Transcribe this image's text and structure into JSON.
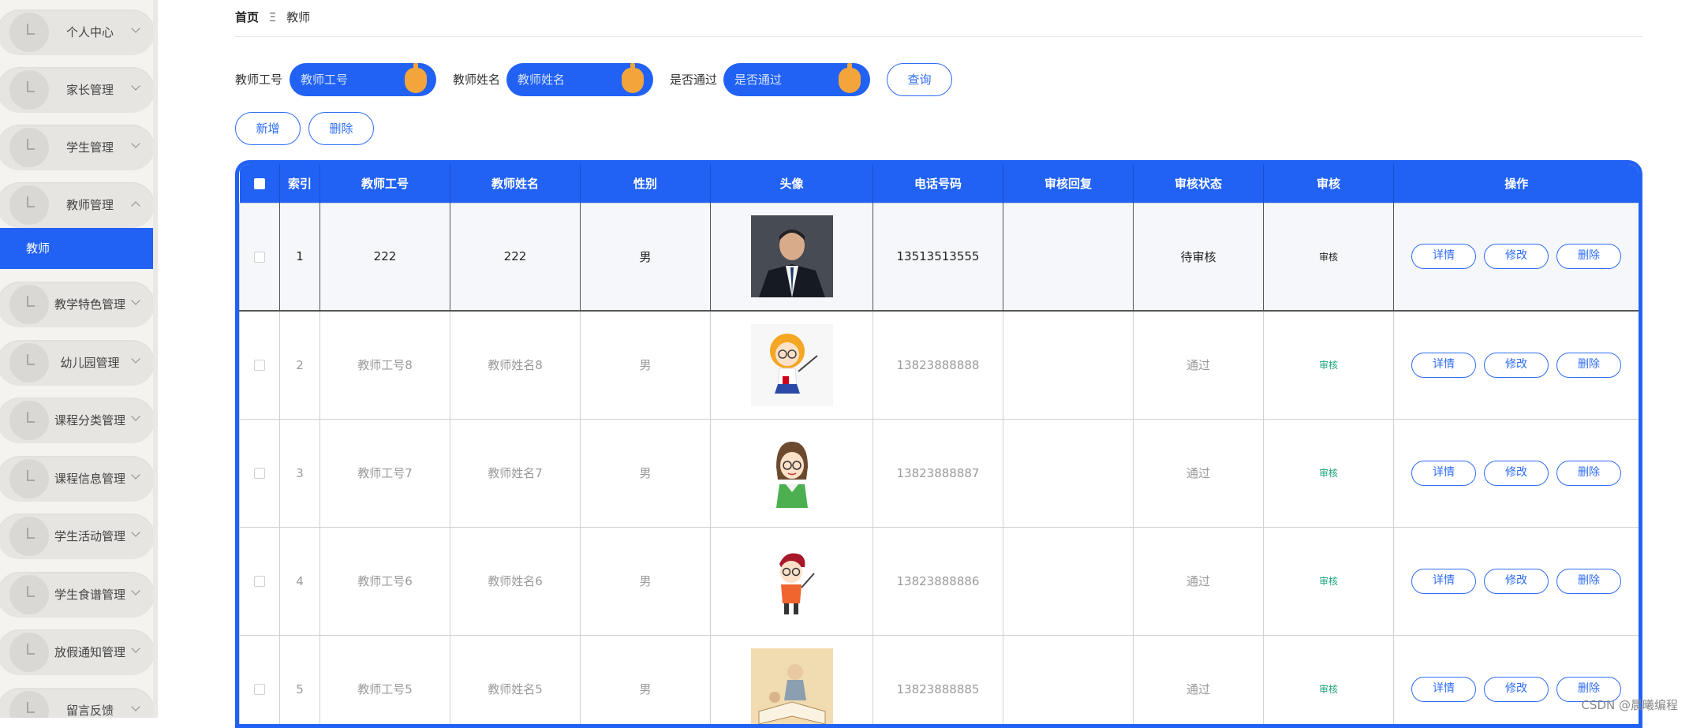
{
  "sidebar": {
    "items": [
      {
        "label": "个人中心"
      },
      {
        "label": "家长管理"
      },
      {
        "label": "学生管理"
      },
      {
        "label": "教师管理"
      },
      {
        "label": "教学特色管理"
      },
      {
        "label": "幼儿园管理"
      },
      {
        "label": "课程分类管理"
      },
      {
        "label": "课程信息管理"
      },
      {
        "label": "学生活动管理"
      },
      {
        "label": "学生食谱管理"
      },
      {
        "label": "放假通知管理"
      },
      {
        "label": "留言反馈"
      }
    ],
    "active_sub": "教师"
  },
  "breadcrumb": {
    "home": "首页",
    "separator": "Ξ",
    "current": "教师"
  },
  "search": {
    "fields": [
      {
        "label": "教师工号",
        "placeholder": "教师工号"
      },
      {
        "label": "教师姓名",
        "placeholder": "教师姓名"
      },
      {
        "label": "是否通过",
        "placeholder": "是否通过"
      }
    ],
    "query_label": "查询"
  },
  "actions": {
    "add_label": "新增",
    "delete_label": "删除"
  },
  "table": {
    "headers": [
      "索引",
      "教师工号",
      "教师姓名",
      "性别",
      "头像",
      "电话号码",
      "审核回复",
      "审核状态",
      "审核",
      "操作"
    ],
    "rows": [
      {
        "index": "1",
        "teacher_no": "222",
        "teacher_name": "222",
        "gender": "男",
        "avatar": "man-in-suit",
        "phone": "13513513555",
        "reply": "",
        "status": "待审核",
        "audit": "审核"
      },
      {
        "index": "2",
        "teacher_no": "教师工号8",
        "teacher_name": "教师姓名8",
        "gender": "男",
        "avatar": "cartoon-girl-teacher",
        "phone": "13823888888",
        "reply": "",
        "status": "通过",
        "audit": "审核"
      },
      {
        "index": "3",
        "teacher_no": "教师工号7",
        "teacher_name": "教师姓名7",
        "gender": "男",
        "avatar": "cartoon-woman-teacher",
        "phone": "13823888887",
        "reply": "",
        "status": "通过",
        "audit": "审核"
      },
      {
        "index": "4",
        "teacher_no": "教师工号6",
        "teacher_name": "教师姓名6",
        "gender": "男",
        "avatar": "cartoon-boy-teacher",
        "phone": "13823888886",
        "reply": "",
        "status": "通过",
        "audit": "审核"
      },
      {
        "index": "5",
        "teacher_no": "教师工号5",
        "teacher_name": "教师姓名5",
        "gender": "男",
        "avatar": "reading-illustration",
        "phone": "13823888885",
        "reply": "",
        "status": "通过",
        "audit": "审核"
      }
    ],
    "row_actions": {
      "detail": "详情",
      "edit": "修改",
      "delete": "删除"
    }
  },
  "watermark": "CSDN @晨曦编程",
  "colors": {
    "primary": "#2162f4",
    "knob": "#f3a53c",
    "audit_text": "#1aa37a"
  }
}
